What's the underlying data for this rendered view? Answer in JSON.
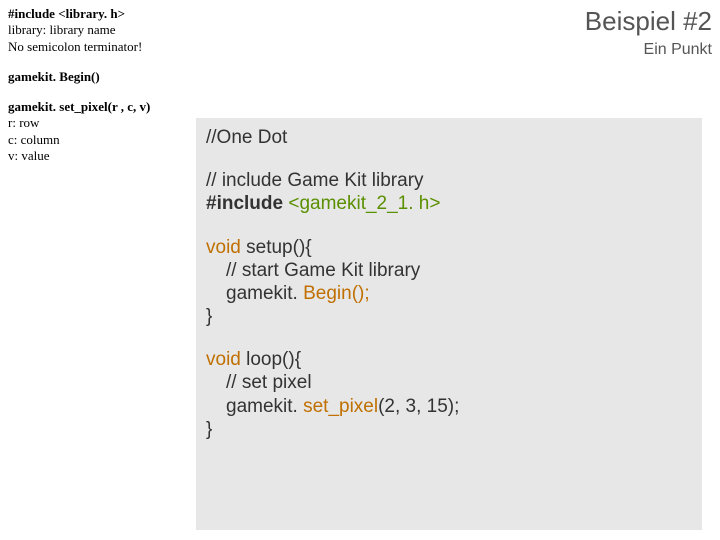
{
  "header": {
    "title": "Beispiel #2",
    "subtitle": "Ein Punkt"
  },
  "left": {
    "include_head": "#include <library. h>",
    "include_l1": "library: library name",
    "include_l2": "No semicolon terminator!",
    "begin_head": "gamekit. Begin()",
    "setpx_head": "gamekit. set_pixel(r , c, v)",
    "setpx_l1": "r: row",
    "setpx_l2": "c: column",
    "setpx_l3": "v: value"
  },
  "code": {
    "c01": "//One Dot",
    "c02_a": "// include Game Kit library",
    "inc_hash": "#include ",
    "inc_hdr": "<gamekit_2_1. h>",
    "void": "void",
    "setup_decl": " setup(){",
    "setup_cmt": "// start Game Kit library",
    "gk_prefix": "gamekit. ",
    "begin_call": "Begin();",
    "loop_decl": " loop(){",
    "loop_cmt": "// set pixel",
    "setpx_call_a": "set_pixel",
    "setpx_call_b": "(2, 3, 15);",
    "close_brace": "}"
  }
}
